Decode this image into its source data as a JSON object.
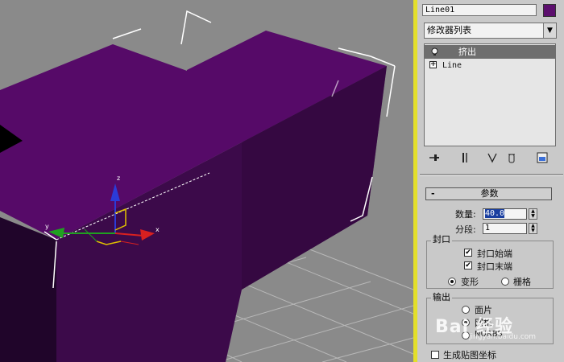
{
  "panel": {
    "object_name": "Line01",
    "object_color": "#5c0f6e",
    "modifier_list": "修改器列表",
    "dropdown_arrow": "▼",
    "stack": [
      {
        "label": "挤出",
        "icon": "lightbulb-icon"
      },
      {
        "label": "Line",
        "icon": "plus-box-icon",
        "expander": "+"
      }
    ],
    "toolbar_icons": [
      "pin-stack-icon",
      "show-end-result-icon",
      "make-unique-icon",
      "remove-modifier-icon",
      "configure-modifier-sets-icon"
    ]
  },
  "params": {
    "rollout_minus": "-",
    "rollout_title": "参数",
    "amount_label": "数量:",
    "amount_value": "40.0",
    "segments_label": "分段:",
    "segments_value": "1",
    "cap_group": "封口",
    "cap_start_label": "封口始端",
    "cap_start_mark": "✔",
    "cap_end_label": "封口末端",
    "cap_end_mark": "✔",
    "morph_label": "变形",
    "grid_label": "栅格",
    "output_group": "输出",
    "output_patch": "面片",
    "output_mesh": "网格",
    "output_nurbs": "NURBS",
    "gen_mapping_label": "生成贴图坐标"
  },
  "viewport": {
    "shape_color": "#560a68",
    "axis_x": "x",
    "axis_y": "y",
    "axis_z": "z"
  },
  "watermark": {
    "text": "Bai 经验",
    "sub": "jingyan.baidu.com"
  }
}
